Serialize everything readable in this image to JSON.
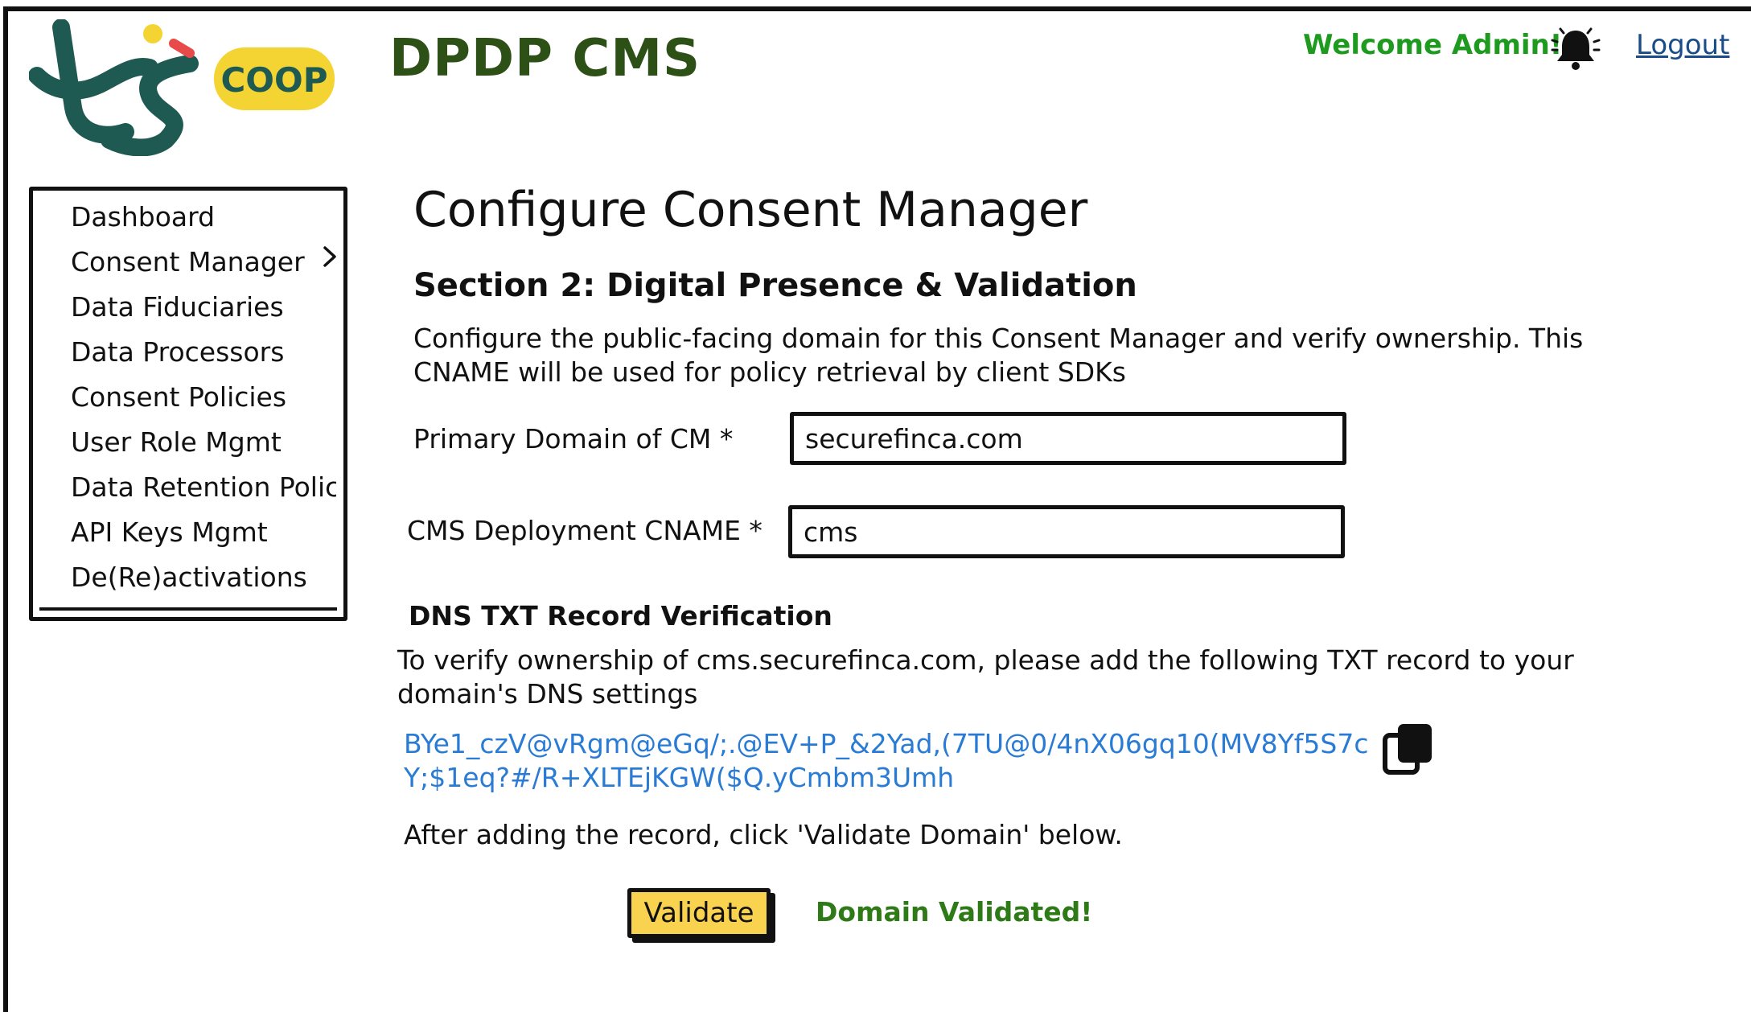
{
  "header": {
    "logo_text": "COOP",
    "app_title": "DPDP CMS",
    "welcome": "Welcome Admin!",
    "logout": "Logout"
  },
  "sidebar": {
    "items": [
      {
        "label": "Dashboard"
      },
      {
        "label": "Consent Manager",
        "has_submenu": true
      },
      {
        "label": "Data Fiduciaries"
      },
      {
        "label": "Data Processors"
      },
      {
        "label": "Consent Policies"
      },
      {
        "label": "User Role Mgmt"
      },
      {
        "label": "Data Retention Polic"
      },
      {
        "label": "API Keys Mgmt"
      },
      {
        "label": "De(Re)activations"
      }
    ]
  },
  "main": {
    "page_title": "Configure Consent Manager",
    "section_title": "Section 2: Digital Presence & Validation",
    "description": "Configure the public-facing domain for this Consent Manager and verify ownership. This CNAME will be used for policy retrieval by client SDKs",
    "fields": {
      "primary_domain": {
        "label": "Primary Domain of CM *",
        "value": "securefinca.com"
      },
      "cname": {
        "label": "CMS Deployment CNAME *",
        "value": "cms"
      }
    },
    "dns": {
      "heading": "DNS TXT Record Verification",
      "description": "To verify ownership of cms.securefinca.com, please add the following TXT record to your domain's DNS settings",
      "record": "BYe1_czV@vRgm@eGq/;.@EV+P_&2Yad,(7TU@0/4nX06gq10(MV8Yf5S7cY;$1eq?#/R+XLTEjKGW($Q.yCmbm3Umh",
      "after_text": "After adding the record, click 'Validate Domain' below."
    },
    "validate_label": "Validate",
    "status": "Domain Validated!"
  },
  "colors": {
    "title_green": "#2d5016",
    "welcome_green": "#1e9a1e",
    "link_blue": "#1a4c8a",
    "record_blue": "#2a7bd4",
    "button_yellow": "#f9d350",
    "status_green": "#2d7a17"
  },
  "icons": [
    "logo-icon",
    "bell-icon",
    "chevron-right-icon",
    "copy-icon"
  ]
}
